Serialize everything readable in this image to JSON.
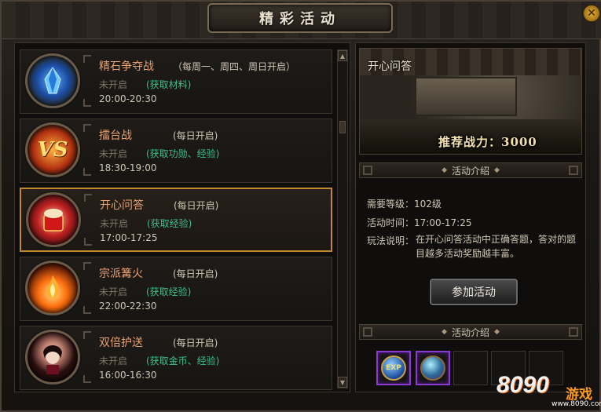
{
  "window": {
    "title": "精彩活动",
    "close_icon": "close-icon"
  },
  "activities": [
    {
      "name": "精石争夺战",
      "schedule": "（每周一、周四、周日开启）",
      "status": "未开启",
      "reward": "(获取材料)",
      "time": "20:00-20:30",
      "icon": "blue-crystal-icon"
    },
    {
      "name": "擂台战",
      "schedule": "(每日开启)",
      "status": "未开启",
      "reward": "(获取功勋、经验)",
      "time": "18:30-19:00",
      "icon": "versus-icon"
    },
    {
      "name": "开心问答",
      "schedule": "(每日开启)",
      "status": "未开启",
      "reward": "(获取经验)",
      "time": "17:00-17:25",
      "icon": "red-scroll-icon",
      "selected": true
    },
    {
      "name": "宗派篝火",
      "schedule": "(每日开启)",
      "status": "未开启",
      "reward": "(获取经验)",
      "time": "22:00-22:30",
      "icon": "bonfire-icon"
    },
    {
      "name": "双倍护送",
      "schedule": "(每日开启)",
      "status": "未开启",
      "reward": "(获取金币、经验)",
      "time": "16:00-16:30",
      "icon": "lady-portrait-icon"
    }
  ],
  "detail": {
    "banner_title": "开心问答",
    "banner_power": "推荐战力：3000",
    "section_intro": "活动介绍",
    "level_label": "需要等级：102级",
    "time_label": "活动时间：17:00-17:25",
    "desc_label": "玩法说明：",
    "desc_text": "在开心问答活动中正确答题，答对的题目越多活动奖励越丰富。",
    "join_button": "参加活动",
    "section_reward": "活动介绍",
    "rewards": [
      {
        "icon": "exp-orb-icon",
        "label": "EXP"
      },
      {
        "icon": "crystal-orb-icon"
      }
    ]
  },
  "watermark": {
    "num": "8090",
    "text": "游戏",
    "domain": "www.8090.com"
  }
}
